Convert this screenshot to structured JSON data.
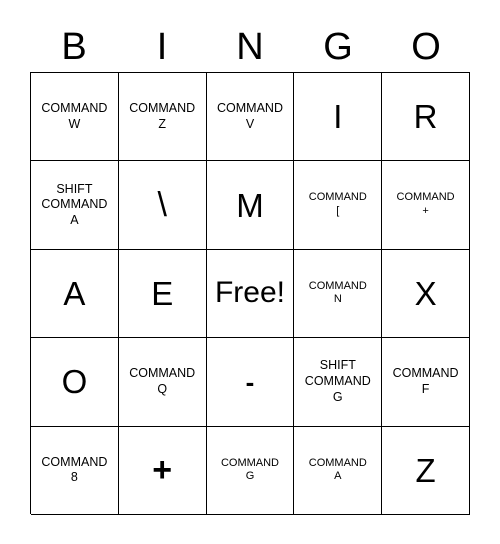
{
  "card": {
    "title_letters": [
      "B",
      "I",
      "N",
      "G",
      "O"
    ],
    "free_space_label": "Free!",
    "rows": [
      [
        {
          "text": "COMMAND\nW",
          "style": "small"
        },
        {
          "text": "COMMAND\nZ",
          "style": "small"
        },
        {
          "text": "COMMAND\nV",
          "style": "small"
        },
        {
          "text": "I",
          "style": "big"
        },
        {
          "text": "R",
          "style": "big"
        }
      ],
      [
        {
          "text": "SHIFT\nCOMMAND\nA",
          "style": "small"
        },
        {
          "text": "\\",
          "style": "backslash"
        },
        {
          "text": "M",
          "style": "big"
        },
        {
          "text": "COMMAND\n[",
          "style": "xsmall"
        },
        {
          "text": "COMMAND\n+",
          "style": "xsmall"
        }
      ],
      [
        {
          "text": "A",
          "style": "big"
        },
        {
          "text": "E",
          "style": "big"
        },
        {
          "text": "Free!",
          "style": "free"
        },
        {
          "text": "COMMAND\nN",
          "style": "xsmall"
        },
        {
          "text": "X",
          "style": "big"
        }
      ],
      [
        {
          "text": "O",
          "style": "big"
        },
        {
          "text": "COMMAND\nQ",
          "style": "small"
        },
        {
          "text": "-",
          "style": "dash"
        },
        {
          "text": "SHIFT\nCOMMAND\nG",
          "style": "small"
        },
        {
          "text": "COMMAND\nF",
          "style": "small"
        }
      ],
      [
        {
          "text": "COMMAND\n8",
          "style": "small"
        },
        {
          "text": "+",
          "style": "plus"
        },
        {
          "text": "COMMAND\nG",
          "style": "xsmall"
        },
        {
          "text": "COMMAND\nA",
          "style": "xsmall"
        },
        {
          "text": "Z",
          "style": "big"
        }
      ]
    ]
  },
  "colors": {
    "border": "#000000",
    "text": "#000000",
    "background": "#ffffff"
  }
}
